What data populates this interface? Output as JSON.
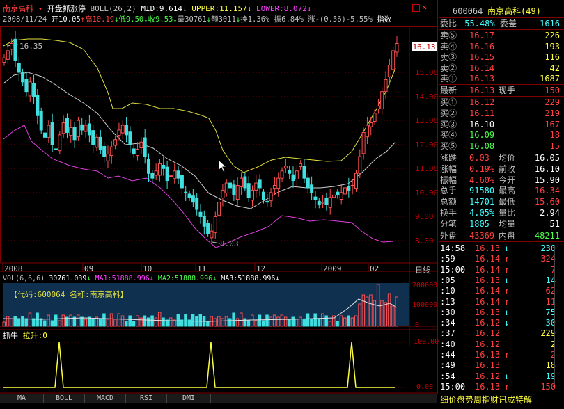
{
  "header": {
    "stock_name": "南京高科",
    "indicator": "开盘抓涨停",
    "boll": "BOLL(26,2)",
    "mid": "MID:9.614",
    "upper": "UPPER:11.157",
    "lower": "LOWER:8.072",
    "date": "2008/11/24",
    "open": "开10.05",
    "high": "高10.19",
    "low": "低9.50",
    "close": "收9.53",
    "vol": "量30761",
    "amount": "额3011",
    "turnover": "换1.36%",
    "amplitude": "振6.84%",
    "change": "涨-(0.56)-5.55%",
    "tail": "指数"
  },
  "price_axis": [
    "15.00",
    "14.00",
    "13.00",
    "12.00",
    "11.00",
    "10.00",
    "9.00",
    "8.00"
  ],
  "price_tag": "16.13",
  "hi_label": "16.35",
  "lo_label": "8.03",
  "time_axis": [
    "2008",
    "09",
    "10",
    "11",
    "12",
    "2009",
    "02"
  ],
  "time_axis_tail": "日线",
  "vol_header": {
    "label": "VOL(6,6,6)",
    "val": "30761.039",
    "ma1": "MA1:51888.996",
    "ma2": "MA2:51888.996",
    "ma3": "MA3:51888.996"
  },
  "vol_box": "【代码:600064 名称:南京高科】",
  "vol_axis": [
    "200000",
    "100000",
    "0"
  ],
  "ind_header": {
    "name": "抓牛",
    "val": "拉升:0"
  },
  "ind_axis": [
    "100.00",
    "0.00"
  ],
  "tabs": [
    "MA",
    "BOLL",
    "MACD",
    "RSI",
    "DMI"
  ],
  "bottom_text": "细价盘势周指财讯成特解",
  "right": {
    "code": "600064",
    "name": "南京高科(49)",
    "webi_label": "委比",
    "webi": "-55.48%",
    "weicha_label": "委差",
    "weicha": "-1616",
    "asks": [
      {
        "label": "卖⑤",
        "price": "16.17",
        "vol": "226"
      },
      {
        "label": "卖④",
        "price": "16.16",
        "vol": "193"
      },
      {
        "label": "卖③",
        "price": "16.15",
        "vol": "116"
      },
      {
        "label": "卖②",
        "price": "16.14",
        "vol": "42"
      },
      {
        "label": "卖①",
        "price": "16.13",
        "vol": "1687"
      }
    ],
    "last": {
      "label": "最新",
      "price": "16.13",
      "lbl2": "现手",
      "vol": "150"
    },
    "bids": [
      {
        "label": "买①",
        "price": "16.12",
        "vol": "229"
      },
      {
        "label": "买②",
        "price": "16.11",
        "vol": "219"
      },
      {
        "label": "买③",
        "price": "16.10",
        "vol": "167"
      },
      {
        "label": "买④",
        "price": "16.09",
        "vol": "18"
      },
      {
        "label": "买⑤",
        "price": "16.08",
        "vol": "15"
      }
    ],
    "stats": [
      {
        "l1": "涨跌",
        "v1": "0.03",
        "l2": "均价",
        "v2": "16.05"
      },
      {
        "l1": "涨幅",
        "v1": "0.19%",
        "l2": "前收",
        "v2": "16.10"
      },
      {
        "l1": "振幅",
        "v1": "4.60%",
        "l2": "今开",
        "v2": "15.90"
      },
      {
        "l1": "总手",
        "v1": "91580",
        "l2": "最高",
        "v2": "16.34"
      },
      {
        "l1": "总额",
        "v1": "14701",
        "l2": "最低",
        "v2": "15.60"
      },
      {
        "l1": "换手",
        "v1": "4.05%",
        "l2": "量比",
        "v2": "2.94"
      },
      {
        "l1": "分笔",
        "v1": "1805",
        "l2": "均量",
        "v2": "51"
      }
    ],
    "outer_label": "外盘",
    "outer": "43369",
    "inner_label": "内盘",
    "inner": "48211",
    "ticks": [
      {
        "t": "14:58",
        "p": "16.13",
        "d": "↓",
        "v": "230"
      },
      {
        "t": ":59",
        "p": "16.14",
        "d": "↑",
        "v": "324"
      },
      {
        "t": "15:00",
        "p": "16.14",
        "d": "↑",
        "v": "7"
      },
      {
        "t": ":05",
        "p": "16.13",
        "d": "↓",
        "v": "14"
      },
      {
        "t": ":10",
        "p": "16.14",
        "d": "↑",
        "v": "62"
      },
      {
        "t": ":13",
        "p": "16.14",
        "d": "↑",
        "v": "11"
      },
      {
        "t": ":30",
        "p": "16.13",
        "d": "↓",
        "v": "75"
      },
      {
        "t": ":34",
        "p": "16.12",
        "d": "↓",
        "v": "30"
      },
      {
        "t": ":37",
        "p": "16.12",
        "d": "",
        "v": "229"
      },
      {
        "t": ":40",
        "p": "16.12",
        "d": "",
        "v": "2"
      },
      {
        "t": ":44",
        "p": "16.13",
        "d": "↑",
        "v": "2"
      },
      {
        "t": ":49",
        "p": "16.13",
        "d": "",
        "v": "18"
      },
      {
        "t": ":54",
        "p": "16.12",
        "d": "↓",
        "v": "19"
      },
      {
        "t": "15:00",
        "p": "16.13",
        "d": "↑",
        "v": "150"
      }
    ]
  }
}
